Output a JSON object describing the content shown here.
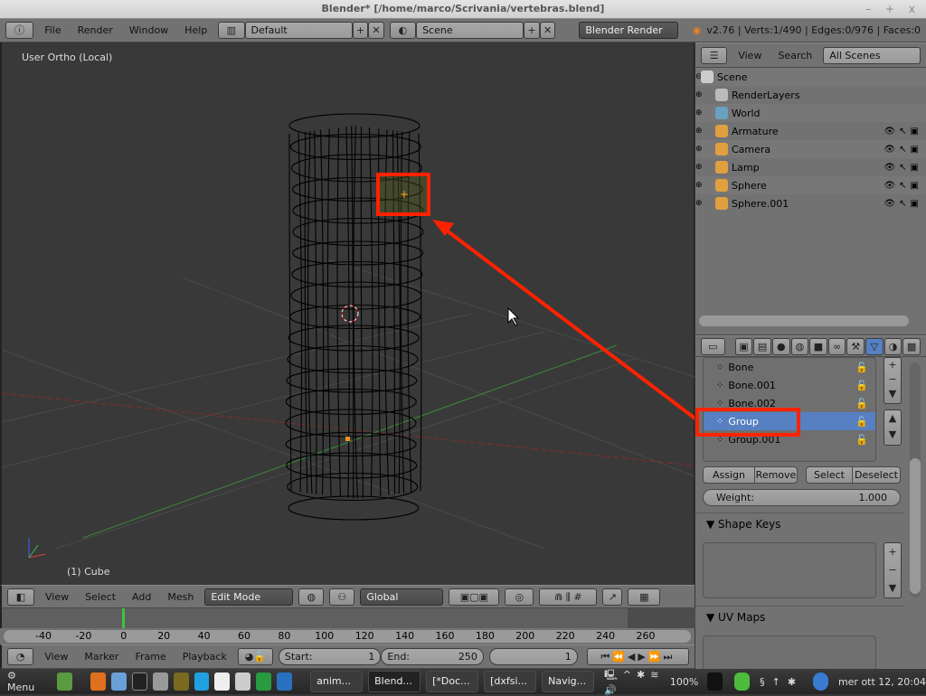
{
  "window": {
    "title": "Blender* [/home/marco/Scrivania/vertebras.blend]",
    "controls": "– + x"
  },
  "topbar": {
    "menus": [
      "File",
      "Render",
      "Window",
      "Help"
    ],
    "layout": "Default",
    "scene": "Scene",
    "engine": "Blender Render",
    "stats": "v2.76 | Verts:1/490 | Edges:0/976 | Faces:0"
  },
  "viewport": {
    "view_label": "User Ortho (Local)",
    "object_label": "(1) Cube"
  },
  "viewport_header": {
    "menus": [
      "View",
      "Select",
      "Add",
      "Mesh"
    ],
    "mode": "Edit Mode",
    "orientation": "Global"
  },
  "outliner": {
    "menus": [
      "View",
      "Search"
    ],
    "filter": "All Scenes",
    "items": [
      {
        "label": "Scene",
        "icon": "scene-icon"
      },
      {
        "label": "RenderLayers",
        "icon": "render-layers-icon"
      },
      {
        "label": "World",
        "icon": "world-icon"
      },
      {
        "label": "Armature",
        "icon": "armature-icon"
      },
      {
        "label": "Camera",
        "icon": "camera-icon"
      },
      {
        "label": "Lamp",
        "icon": "lamp-icon"
      },
      {
        "label": "Sphere",
        "icon": "mesh-icon"
      },
      {
        "label": "Sphere.001",
        "icon": "mesh-icon"
      }
    ]
  },
  "properties": {
    "vertex_groups": [
      "Bone",
      "Bone.001",
      "Bone.002",
      "Group",
      "Group.001"
    ],
    "selected_group": "Group",
    "buttons": {
      "assign": "Assign",
      "remove": "Remove",
      "select": "Select",
      "deselect": "Deselect"
    },
    "weight_label": "Weight:",
    "weight_value": "1.000",
    "shape_keys": "Shape Keys",
    "uv_maps": "UV Maps"
  },
  "timeline": {
    "ticks": [
      "-40",
      "-20",
      "0",
      "20",
      "40",
      "60",
      "80",
      "100",
      "120",
      "140",
      "160",
      "180",
      "200",
      "220",
      "240",
      "260"
    ],
    "menus": [
      "View",
      "Marker",
      "Frame",
      "Playback"
    ],
    "start_label": "Start:",
    "start": "1",
    "end_label": "End:",
    "end": "250",
    "current": "1"
  },
  "taskbar": {
    "menu": "Menu",
    "tasks": [
      "anim...",
      "Blend...",
      "[*Doc...",
      "[dxfsi...",
      "Navig..."
    ],
    "battery": "100%",
    "clock": "mer ott 12, 20:04"
  },
  "colors": {
    "accent": "#5680c2",
    "annotation": "#ff2200",
    "viewport": "#393939",
    "panel": "#727272"
  }
}
